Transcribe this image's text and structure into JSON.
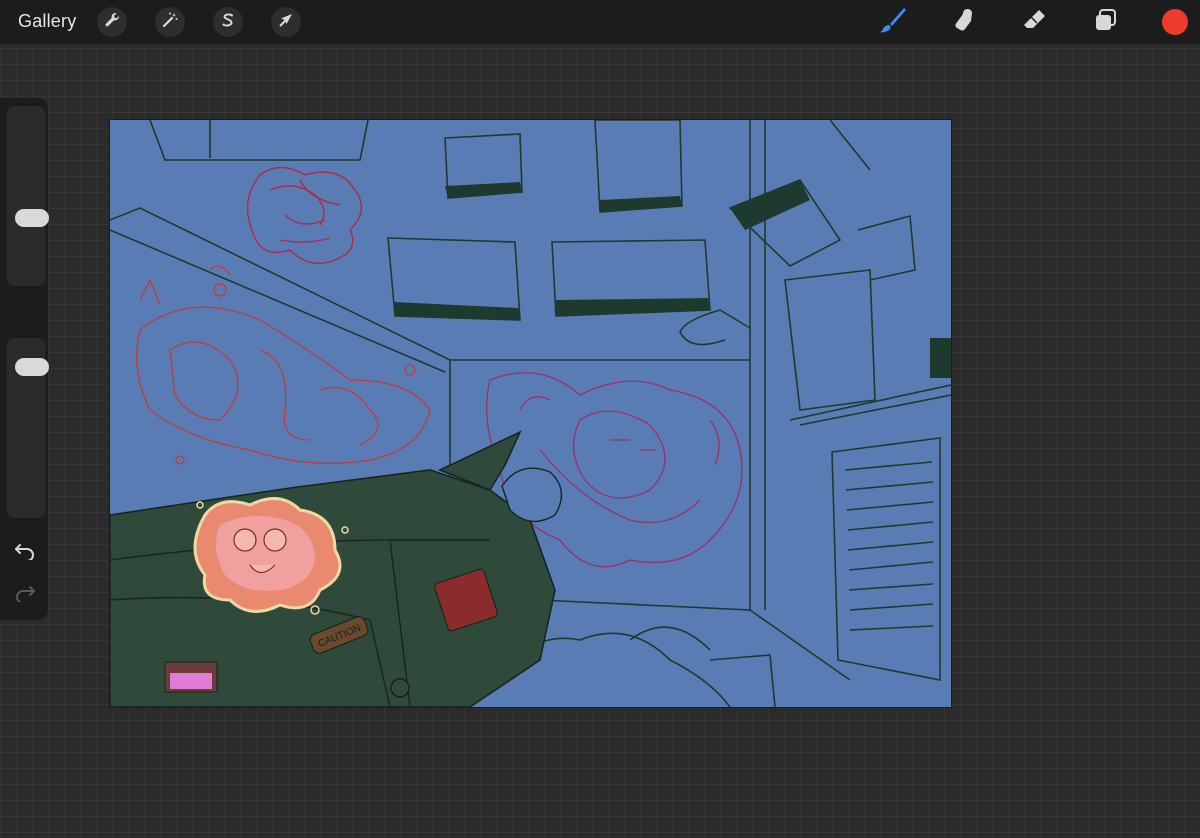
{
  "toolbar": {
    "gallery_label": "Gallery",
    "left_tools": [
      {
        "name": "actions",
        "icon": "wrench-icon"
      },
      {
        "name": "adjustments",
        "icon": "magic-wand-icon"
      },
      {
        "name": "selection",
        "icon": "selection-s-icon"
      },
      {
        "name": "transform",
        "icon": "arrow-cursor-icon"
      }
    ],
    "right_tools": [
      {
        "name": "brush",
        "icon": "brush-icon",
        "active": true
      },
      {
        "name": "smudge",
        "icon": "smudge-finger-icon"
      },
      {
        "name": "eraser",
        "icon": "eraser-icon"
      },
      {
        "name": "layers",
        "icon": "layers-icon"
      }
    ],
    "current_color": "#ee3b2b",
    "active_tool_color": "#3a8ef0"
  },
  "sidebar": {
    "brush_size_level": 0.35,
    "opacity_level": 0.92,
    "buttons": [
      {
        "name": "modify",
        "icon": "square-icon"
      },
      {
        "name": "undo",
        "icon": "undo-icon"
      },
      {
        "name": "redo",
        "icon": "redo-icon"
      }
    ]
  },
  "canvas": {
    "background_color": "#5a7cb5",
    "line_color": "#1e3a2e",
    "graffiti_colors": [
      "#b0284a",
      "#9c2f66",
      "#c23a3a"
    ],
    "dumpster_color": "#2f4a3a",
    "sticker_text": "CAUTION"
  }
}
